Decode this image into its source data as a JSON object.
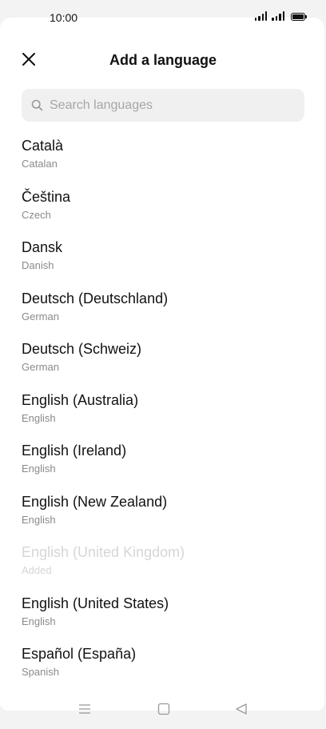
{
  "status_bar": {
    "time": "10:00"
  },
  "header": {
    "title": "Add a language",
    "close_icon": "close-icon"
  },
  "search": {
    "placeholder": "Search languages",
    "value": "",
    "icon": "search-icon"
  },
  "languages": [
    {
      "name": "Català",
      "sub": "Catalan",
      "added": false
    },
    {
      "name": "Čeština",
      "sub": "Czech",
      "added": false
    },
    {
      "name": "Dansk",
      "sub": "Danish",
      "added": false
    },
    {
      "name": "Deutsch (Deutschland)",
      "sub": "German",
      "added": false
    },
    {
      "name": "Deutsch (Schweiz)",
      "sub": "German",
      "added": false
    },
    {
      "name": "English (Australia)",
      "sub": "English",
      "added": false
    },
    {
      "name": "English (Ireland)",
      "sub": "English",
      "added": false
    },
    {
      "name": "English (New Zealand)",
      "sub": "English",
      "added": false
    },
    {
      "name": "English (United Kingdom)",
      "sub": "Added",
      "added": true
    },
    {
      "name": "English (United States)",
      "sub": "English",
      "added": false
    },
    {
      "name": "Español (España)",
      "sub": "Spanish",
      "added": false
    }
  ],
  "nav_bar": {
    "icons": [
      "menu-icon",
      "home-icon",
      "back-icon"
    ]
  },
  "colors": {
    "text_primary": "#111111",
    "text_secondary": "#8a8a8a",
    "text_disabled": "#d6d6d6",
    "search_bg": "#f0f0f0"
  }
}
